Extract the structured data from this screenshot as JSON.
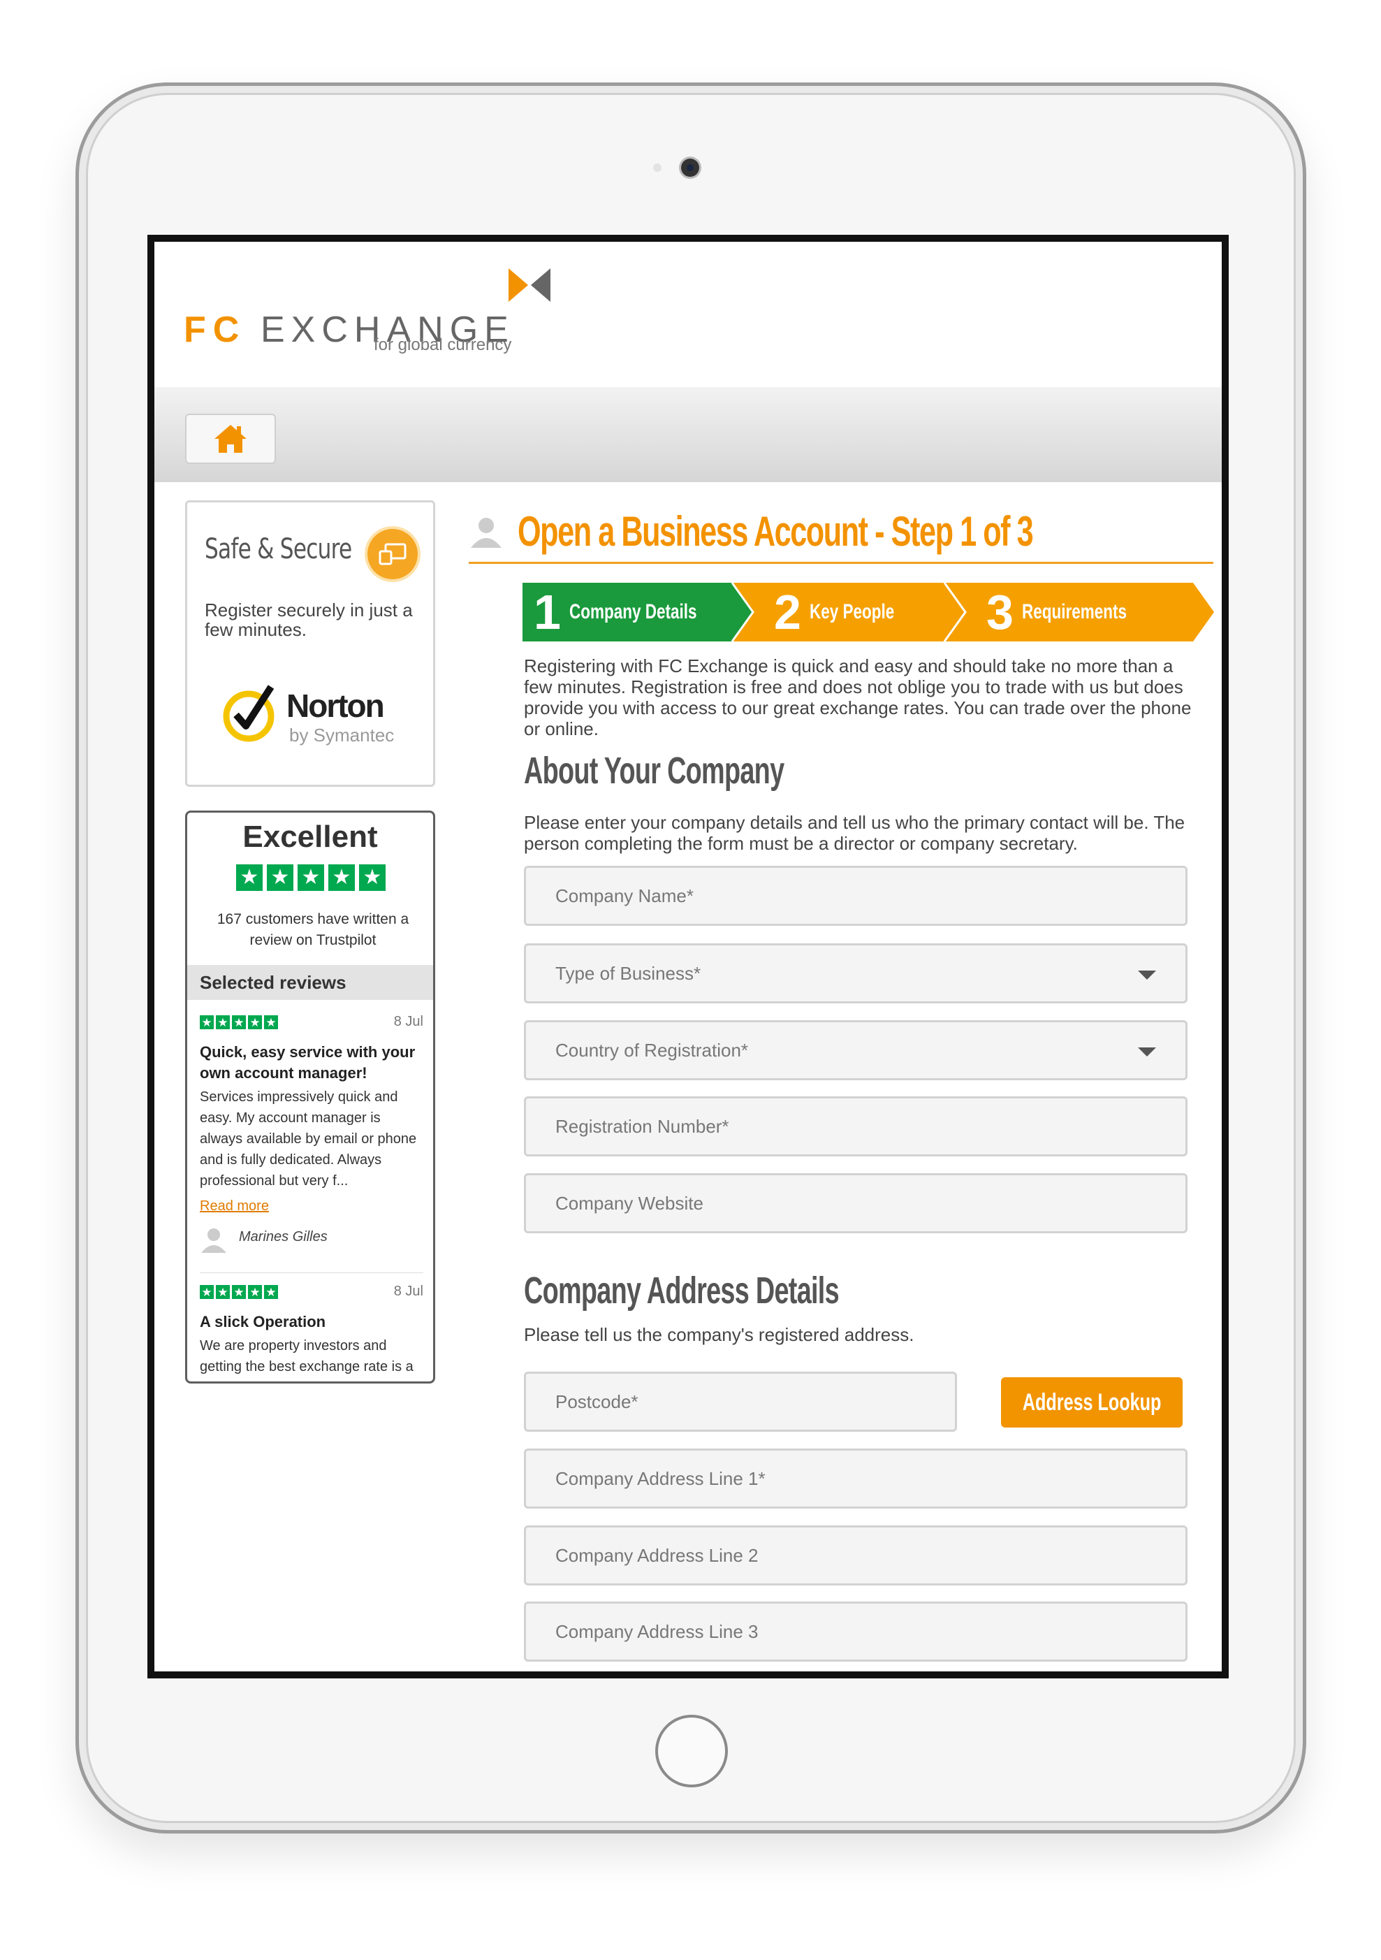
{
  "brand": {
    "fc": "FC",
    "exchange": "EXCHANGE",
    "tagline": "for global currency",
    "orange": "#f39200",
    "green": "#1a9a3c"
  },
  "nav": {
    "home_icon": "home-icon"
  },
  "sidebar": {
    "secure_title": "Safe & Secure",
    "secure_text": "Register securely in just a few minutes.",
    "norton_name": "Norton",
    "norton_sub": "by Symantec",
    "trust_title": "Excellent",
    "trust_count": "167 customers have written a review on Trustpilot",
    "selected_reviews": "Selected reviews",
    "reviews": [
      {
        "date": "8 Jul",
        "title": "Quick, easy service with your own account manager!",
        "body": "Services impressively quick and easy. My account manager is always available by email or phone and is fully dedicated. Always professional but very f...",
        "read_more": "Read more",
        "author": "Marines Gilles"
      },
      {
        "date": "8 Jul",
        "title": "A slick Operation",
        "body": "We are property investors and getting the best exchange rate is a vital part of our bottom line We..."
      }
    ]
  },
  "main": {
    "page_title": "Open a Business Account - Step 1 of 3",
    "steps": [
      {
        "num": "1",
        "label": "Company Details",
        "color": "#1a9a3c"
      },
      {
        "num": "2",
        "label": "Key People",
        "color": "#f5a000"
      },
      {
        "num": "3",
        "label": "Requirements",
        "color": "#f5a000"
      }
    ],
    "intro": "Registering with FC Exchange is quick and easy and should take no more than a few minutes. Registration is free and does not oblige you to trade with us but does provide you with access to our great exchange rates. You can trade over the phone or online.",
    "about_title": "About Your Company",
    "about_text": "Please enter your company details and tell us who the primary contact will be. The person completing the form must be a director or company secretary.",
    "company_fields": {
      "company_name": "Company Name*",
      "type_of_business": "Type of Business*",
      "country_of_registration": "Country of Registration*",
      "registration_number": "Registration Number*",
      "company_website": "Company Website"
    },
    "address_title": "Company Address Details",
    "address_text": "Please tell us the company's registered address.",
    "address_fields": {
      "postcode": "Postcode*",
      "line1": "Company Address Line 1*",
      "line2": "Company Address Line 2",
      "line3": "Company Address Line 3"
    },
    "lookup_label": "Address Lookup"
  }
}
